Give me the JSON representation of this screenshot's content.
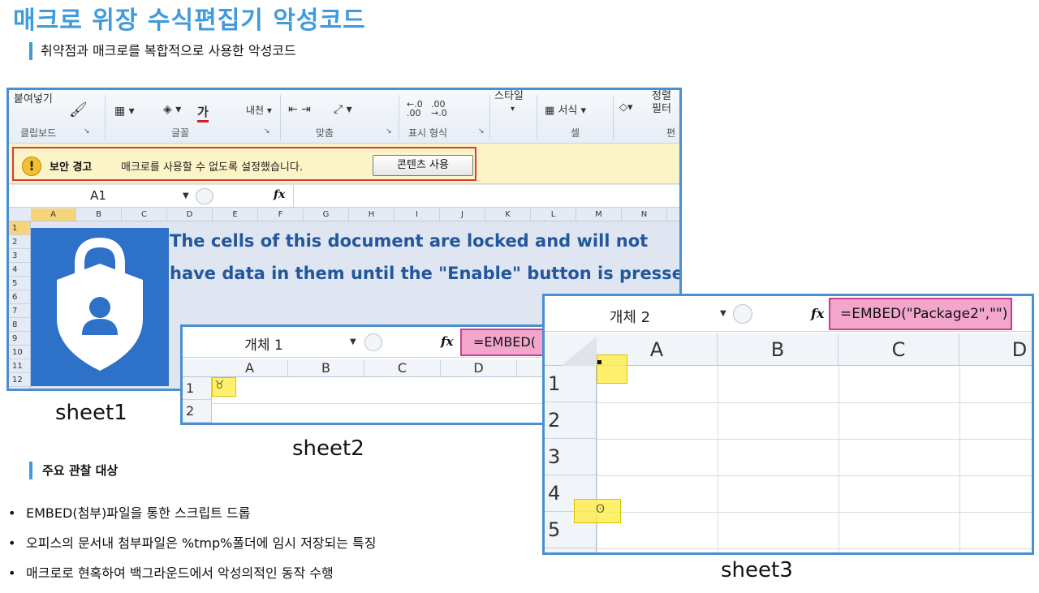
{
  "header": {
    "title": "매크로 위장 수식편집기 악성코드",
    "subtitle": "취약점과 매크로를 복합적으로 사용한 악성코드"
  },
  "ribbon": {
    "paste": "붙여넣기",
    "clipboard_group": "클립보드",
    "font_group": "글꼴",
    "align_group": "맞춤",
    "number_group": "표시 형식",
    "cells_group": "셀",
    "edit_group": "편",
    "style": "스타일",
    "format": "서식 ▾",
    "sort": "정렬",
    "filter": "필터",
    "font_color_glyph": "가",
    "decimal_inc": ".00",
    "decimal_dec": ".00"
  },
  "security_bar": {
    "title": "보안 경고",
    "message": "매크로를 사용할 수 없도록 설정했습니다.",
    "button": "콘텐츠 사용"
  },
  "sheet1": {
    "name_box": "A1",
    "fx": "fx",
    "columns": [
      "A",
      "B",
      "C",
      "D",
      "E",
      "F",
      "G",
      "H",
      "I",
      "J",
      "K",
      "L",
      "M",
      "N"
    ],
    "rows": [
      "1",
      "2",
      "3",
      "4",
      "5",
      "6",
      "7",
      "8",
      "9",
      "10",
      "11",
      "12"
    ],
    "text_line1": "The cells of this document are locked and will not",
    "text_line2": "have data in them until the \"Enable\" button is pressed.",
    "label": "sheet1"
  },
  "sheet2": {
    "name_box": "개체 1",
    "fx": "fx",
    "formula": "=EMBED(",
    "columns": [
      "A",
      "B",
      "C",
      "D"
    ],
    "rows": [
      "1",
      "2"
    ],
    "label": "sheet2"
  },
  "sheet3": {
    "name_box": "개체 2",
    "fx": "fx",
    "formula": "=EMBED(\"Package2\",\"\")",
    "columns": [
      "A",
      "B",
      "C",
      "D"
    ],
    "rows": [
      "1",
      "2",
      "3",
      "4",
      "5"
    ],
    "label": "sheet3"
  },
  "notes": {
    "heading": "주요 관찰 대상",
    "items": [
      "EMBED(첨부)파일을 통한 스크립트 드롭",
      "오피스의 문서내 첨부파일은 %tmp%폴더에 임시 저장되는 특징",
      "매크로로 현혹하여 백그라운드에서 악성의적인 동작 수행"
    ]
  },
  "colors": {
    "accent": "#3f9bdc",
    "frame": "#4a8fd0",
    "warning_border": "#d93a3a",
    "highlight": "#ffec3c",
    "formula_highlight": "#f2a6cc",
    "lock_tile": "#2d71c9"
  }
}
